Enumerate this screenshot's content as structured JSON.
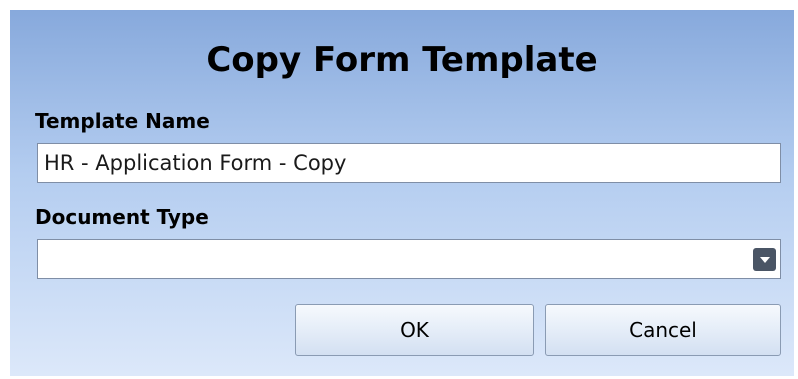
{
  "dialog": {
    "title": "Copy Form Template",
    "template_name_label": "Template Name",
    "template_name_value": "HR - Application Form - Copy",
    "document_type_label": "Document Type",
    "document_type_value": "",
    "dropdown_icon": "chevron-down-icon",
    "ok_label": "OK",
    "cancel_label": "Cancel"
  },
  "colors": {
    "dialog_gradient_top": "#87a9dc",
    "dialog_gradient_bottom": "#dce8fa",
    "dropdown_button": "#4a5565"
  }
}
